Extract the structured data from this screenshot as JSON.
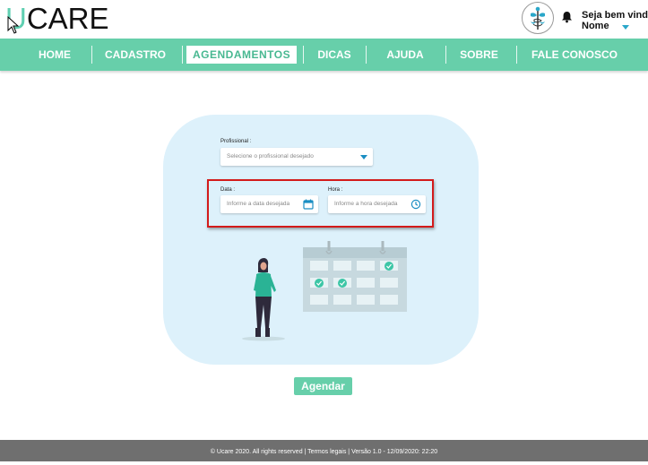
{
  "app": {
    "logo_first": "U",
    "logo_rest": "CARE"
  },
  "user": {
    "greeting": "Seja bem vindo,",
    "name": "Nome"
  },
  "nav": {
    "items": [
      {
        "label": "HOME"
      },
      {
        "label": "CADASTRO"
      },
      {
        "label": "AGENDAMENTOS",
        "active": true
      },
      {
        "label": "DICAS"
      },
      {
        "label": "AJUDA"
      },
      {
        "label": "SOBRE"
      },
      {
        "label": "FALE CONOSCO"
      }
    ]
  },
  "form": {
    "professional_label": "Profissional :",
    "professional_placeholder": "Selecione o profissional desejado",
    "date_label": "Data :",
    "date_placeholder": "Informe a data desejada",
    "time_label": "Hora :",
    "time_placeholder": "Informe a hora desejada",
    "submit_label": "Agendar"
  },
  "footer": {
    "text": "© Ucare  2020. All rights reserved | Termos legais | Versão 1.0 - 12/09/2020: 22:20"
  },
  "colors": {
    "accent": "#67cfaa",
    "card": "#ddf1fb",
    "highlight": "#d31b1b",
    "footer": "#6f6f6f",
    "icon_blue": "#1a8ec3"
  },
  "icons": {
    "bell": "bell-icon",
    "date": "calendar-icon",
    "time": "clock-icon",
    "dropdown": "caret-down-icon"
  }
}
